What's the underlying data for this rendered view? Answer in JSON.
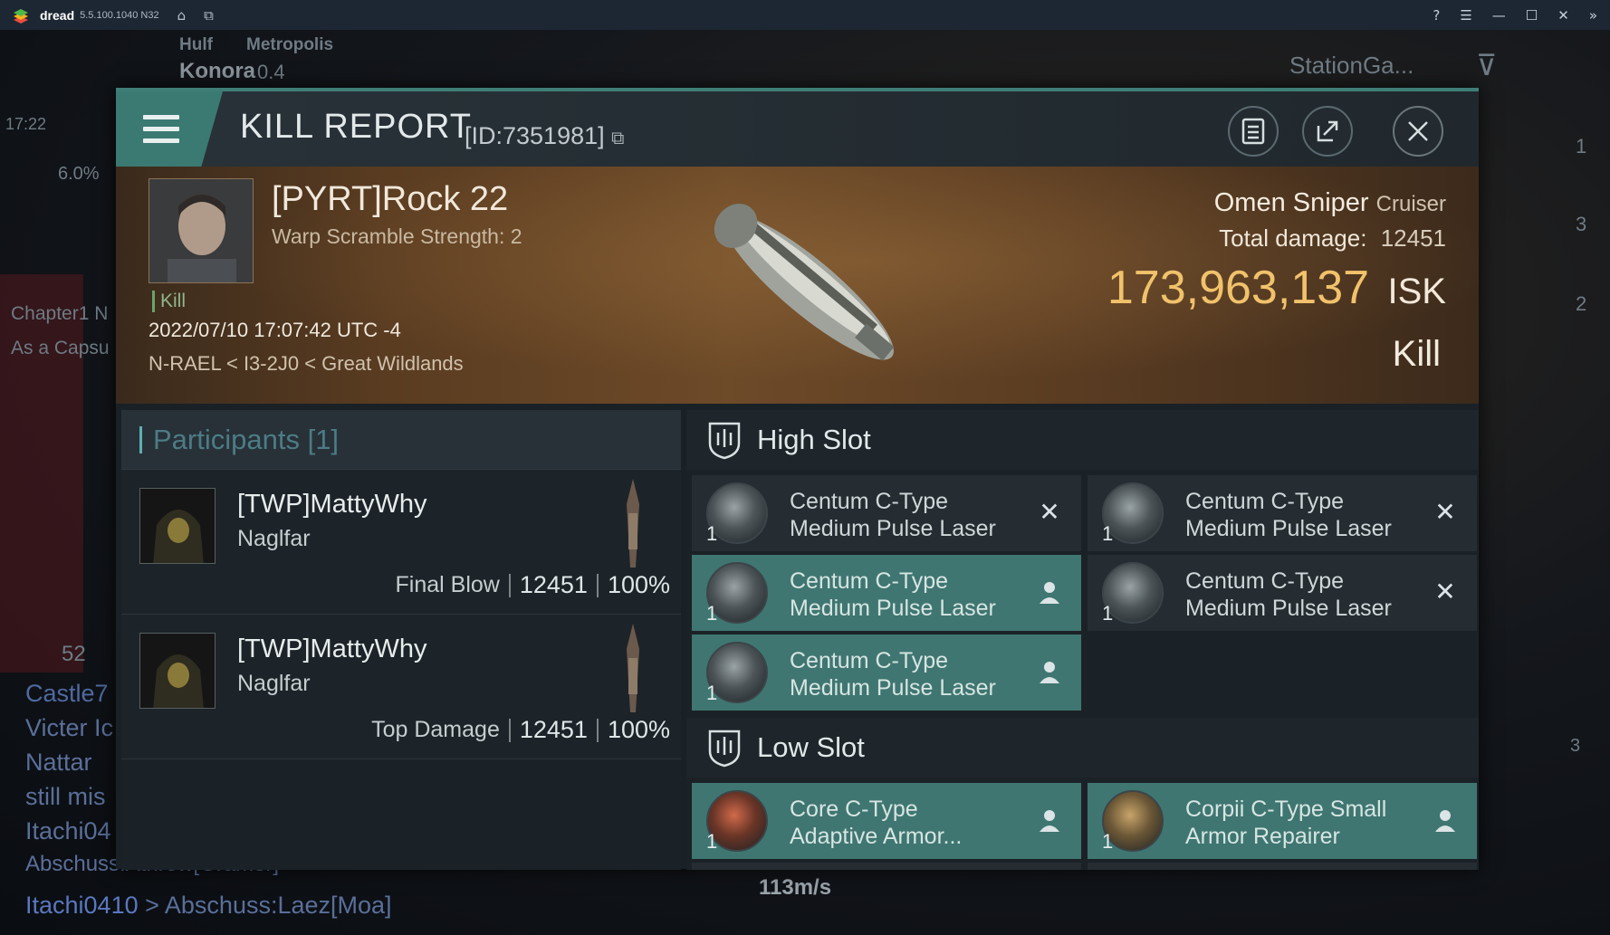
{
  "emulator": {
    "app_name": "dread",
    "version": "5.5.100.1040 N32",
    "icons": [
      "home-icon",
      "multi-window-icon",
      "help-icon",
      "menu-icon",
      "minimize-icon",
      "maximize-icon",
      "close-icon",
      "collapse-icon"
    ]
  },
  "hud": {
    "location_prefix": "Hulf",
    "location_region": "Metropolis",
    "system": "Konora",
    "security": "0.4",
    "clock": "17:22",
    "cargo_pct": "6.0%",
    "chapter_text": "Chapter1 N",
    "capsule_text": "As a Capsu",
    "local_count": "52",
    "station_label": "StationGa...",
    "speed": "113m/s",
    "chat_lines": [
      "Castle7",
      "Victer Ic",
      "Nattar",
      "still mis",
      "Itachi04",
      "Abschuss:Athrow[Gramer]",
      "Itachi0410"
    ],
    "last_chat_sender": "Itachi0410",
    "last_chat_msg": "> Abschuss:Laez[Moa]",
    "right_counts": [
      "1",
      "3",
      "2"
    ],
    "drone_count": "3"
  },
  "report": {
    "title": "KILL REPORT",
    "id_text": "[ID:7351981]",
    "victim": {
      "name": "[PYRT]Rock 22",
      "subline": "Warp Scramble Strength: 2",
      "tag": "Kill",
      "time": "2022/07/10 17:07:42 UTC -4",
      "location": "N-RAEL < I3-2J0 < Great Wildlands"
    },
    "ship": {
      "name": "Omen Sniper",
      "class": "Cruiser",
      "damage_label": "Total damage:",
      "damage_value": "12451",
      "isk_value": "173,963,137",
      "isk_unit": "ISK",
      "result": "Kill"
    },
    "participants": {
      "label": "Participants [1]",
      "rows": [
        {
          "name": "[TWP]MattyWhy",
          "ship": "Naglfar",
          "role": "Final Blow",
          "damage": "12451",
          "pct": "100%"
        },
        {
          "name": "[TWP]MattyWhy",
          "ship": "Naglfar",
          "role": "Top Damage",
          "damage": "12451",
          "pct": "100%"
        }
      ]
    },
    "high_slot": {
      "label": "High Slot",
      "modules": [
        {
          "line1": "Centum C-Type",
          "line2": "Medium Pulse Laser",
          "qty": "1",
          "status": "destroyed"
        },
        {
          "line1": "Centum C-Type",
          "line2": "Medium Pulse Laser",
          "qty": "1",
          "status": "destroyed"
        },
        {
          "line1": "Centum C-Type",
          "line2": "Medium Pulse Laser",
          "qty": "1",
          "status": "dropped"
        },
        {
          "line1": "Centum C-Type",
          "line2": "Medium Pulse Laser",
          "qty": "1",
          "status": "destroyed"
        },
        {
          "line1": "Centum C-Type",
          "line2": "Medium Pulse Laser",
          "qty": "1",
          "status": "dropped"
        }
      ]
    },
    "low_slot": {
      "label": "Low Slot",
      "modules": [
        {
          "line1": "Core C-Type",
          "line2": "Adaptive Armor...",
          "qty": "1",
          "status": "dropped"
        },
        {
          "line1": "Corpii C-Type Small",
          "line2": "Armor Repairer",
          "qty": "1",
          "status": "dropped"
        }
      ]
    },
    "colors": {
      "accent": "#3f7e77",
      "isk": "#f1c26b",
      "dropped_bg": "#3f7671"
    }
  }
}
